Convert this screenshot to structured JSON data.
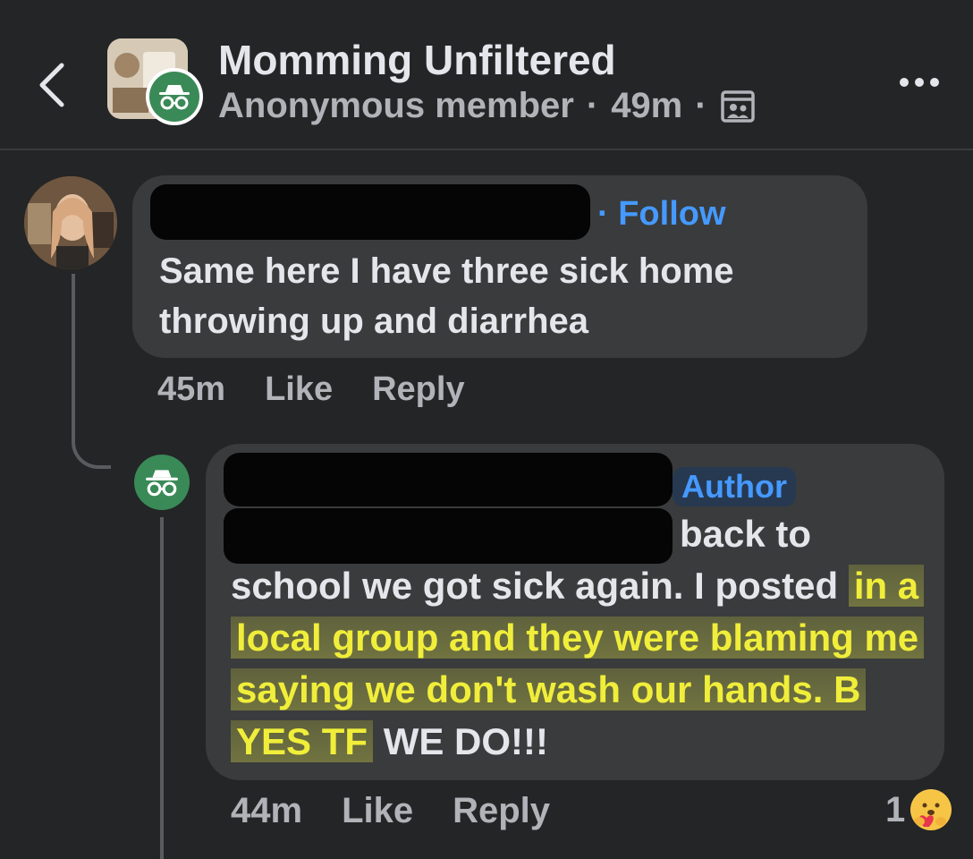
{
  "header": {
    "group_name": "Momming Unfiltered",
    "poster": "Anonymous member",
    "time": "49m",
    "separator": "·"
  },
  "comments": [
    {
      "follow_label": "Follow",
      "text": "Same here I have three sick home throwing up and diarrhea",
      "time": "45m",
      "like_label": "Like",
      "reply_label": "Reply"
    },
    {
      "badge": "Author",
      "text_line1": "back to",
      "text_plain": "school we got sick again. I posted ",
      "text_highlighted": "in a local group and they were blaming me saying we don't wash our hands. B YES TF",
      "text_end": " WE DO!!!",
      "time": "44m",
      "like_label": "Like",
      "reply_label": "Reply",
      "reaction_count": "1"
    }
  ],
  "icons": {
    "back": "chevron-left-icon",
    "more": "more-dots-icon",
    "privacy": "private-group-icon",
    "anon": "incognito-icon",
    "reaction": "care-emoji-icon"
  },
  "colors": {
    "background": "#242526",
    "bubble": "#3a3b3c",
    "link_blue": "#4599ff",
    "highlight": "#f0ee3a",
    "anon_green": "#3a8a57"
  }
}
